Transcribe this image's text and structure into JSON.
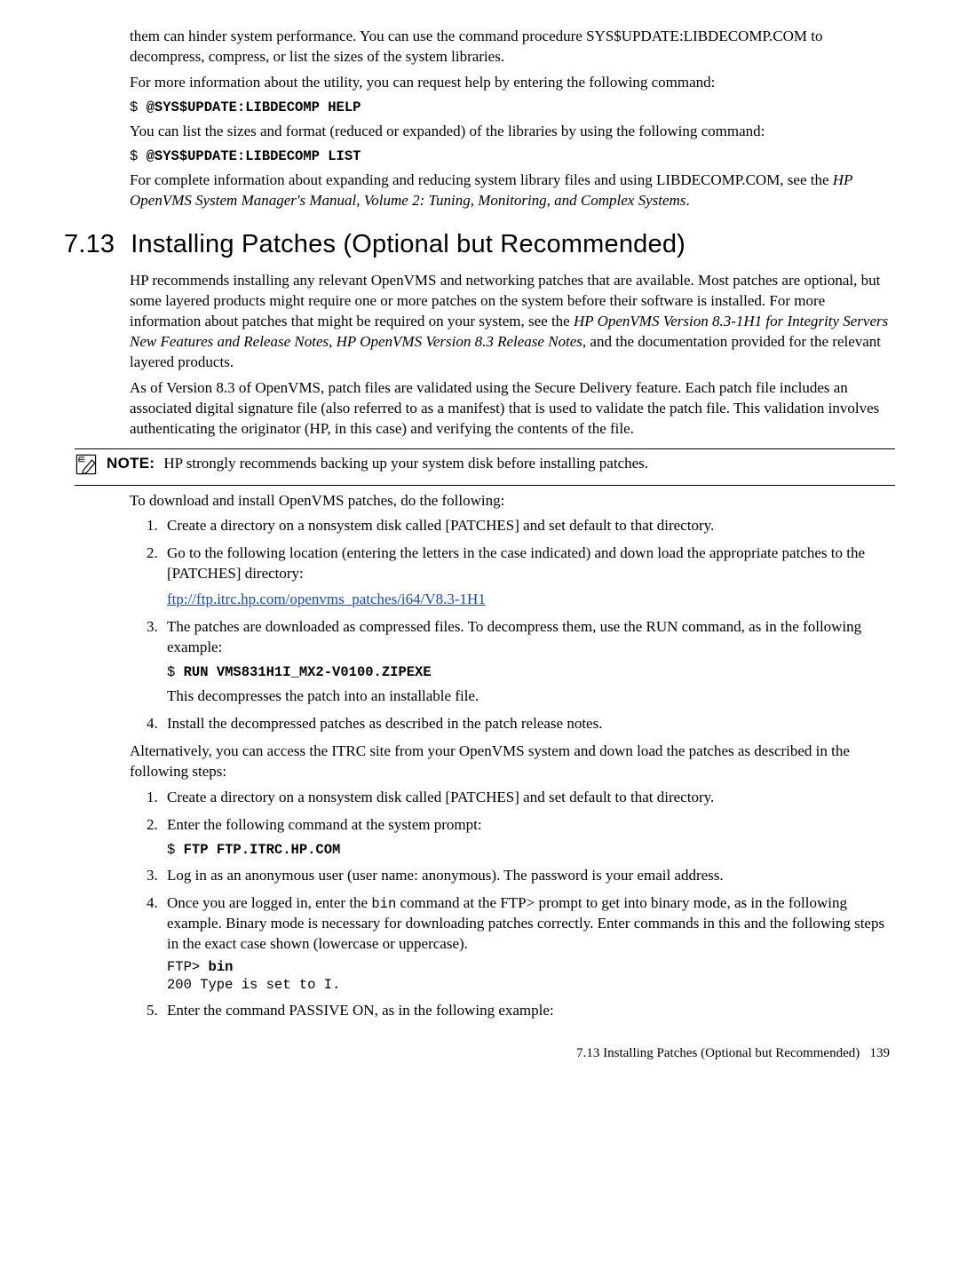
{
  "intro": {
    "p1": "them can hinder system performance. You can use the command procedure SYS$UPDATE:LIBDECOMP.COM to decompress, compress, or list the sizes of the system libraries.",
    "p2": "For more information about the utility, you can request help by entering the following command:",
    "cmd1_prefix": "$ ",
    "cmd1": "@SYS$UPDATE:LIBDECOMP HELP",
    "p3": "You can list the sizes and format (reduced or expanded) of the libraries by using the following command:",
    "cmd2_prefix": "$ ",
    "cmd2": "@SYS$UPDATE:LIBDECOMP LIST",
    "p4a": "For complete information about expanding and reducing system library files and using LIBDECOMP.COM, see the ",
    "p4_em": "HP OpenVMS System Manager's Manual, Volume 2: Tuning, Monitoring, and Complex Systems",
    "p4b": "."
  },
  "section": {
    "num": "7.13",
    "title": "Installing Patches (Optional but Recommended)",
    "p1a": "HP recommends installing any relevant OpenVMS and networking patches that are available. Most patches are optional, but some layered products might require one or more patches on the system before their software is installed. For more information about patches that might be required on your system, see the ",
    "p1_em1": "HP OpenVMS Version 8.3-1H1 for Integrity Servers New Features and Release Notes",
    "p1_mid": ", ",
    "p1_em2": "HP OpenVMS Version 8.3 Release Notes",
    "p1b": ", and the documentation provided for the relevant layered products.",
    "p2": "As of Version 8.3 of OpenVMS, patch files are validated using the Secure Delivery feature. Each patch file includes an associated digital signature file (also referred to as a manifest) that is used to validate the patch file. This validation involves authenticating the originator (HP, in this case) and verifying the contents of the file."
  },
  "note": {
    "label": "NOTE:",
    "text": "HP strongly recommends backing up your system disk before installing patches."
  },
  "download": {
    "intro": "To download and install OpenVMS patches, do the following:",
    "step1": "Create a directory on a nonsystem disk called [PATCHES] and set default to that directory.",
    "step2": "Go to the following location (entering the letters in the case indicated) and down load the appropriate patches to the [PATCHES] directory:",
    "step2_link": "ftp://ftp.itrc.hp.com/openvms_patches/i64/V8.3-1H1",
    "step3": "The patches are downloaded as compressed files. To decompress them, use the RUN command, as in the following example:",
    "step3_cmd_prefix": "$ ",
    "step3_cmd": "RUN VMS831H1I_MX2-V0100.ZIPEXE",
    "step3_after": "This decompresses the patch into an installable file.",
    "step4": "Install the decompressed patches as described in the patch release notes."
  },
  "alt": {
    "intro": "Alternatively, you can access the ITRC site from your OpenVMS system and down load the patches as described in the following steps:",
    "step1": "Create a directory on a nonsystem disk called [PATCHES] and set default to that directory.",
    "step2": "Enter the following command at the system prompt:",
    "step2_cmd_prefix": "$ ",
    "step2_cmd": "FTP FTP.ITRC.HP.COM",
    "step3": "Log in as an anonymous user (user name: anonymous). The password is your email address.",
    "step4a": "Once you are logged in, enter the ",
    "step4_code": "bin",
    "step4b": " command at the FTP> prompt to get into binary mode, as in the following example. Binary mode is necessary for downloading patches correctly. Enter commands in this and the following steps in the exact case shown (lowercase or uppercase).",
    "step4_line1_prefix": "FTP> ",
    "step4_line1_cmd": "bin",
    "step4_line2": "200 Type is set to I.",
    "step5": "Enter the command PASSIVE ON, as in the following example:"
  },
  "footer": {
    "text": "7.13 Installing Patches (Optional but Recommended)",
    "page": "139"
  }
}
